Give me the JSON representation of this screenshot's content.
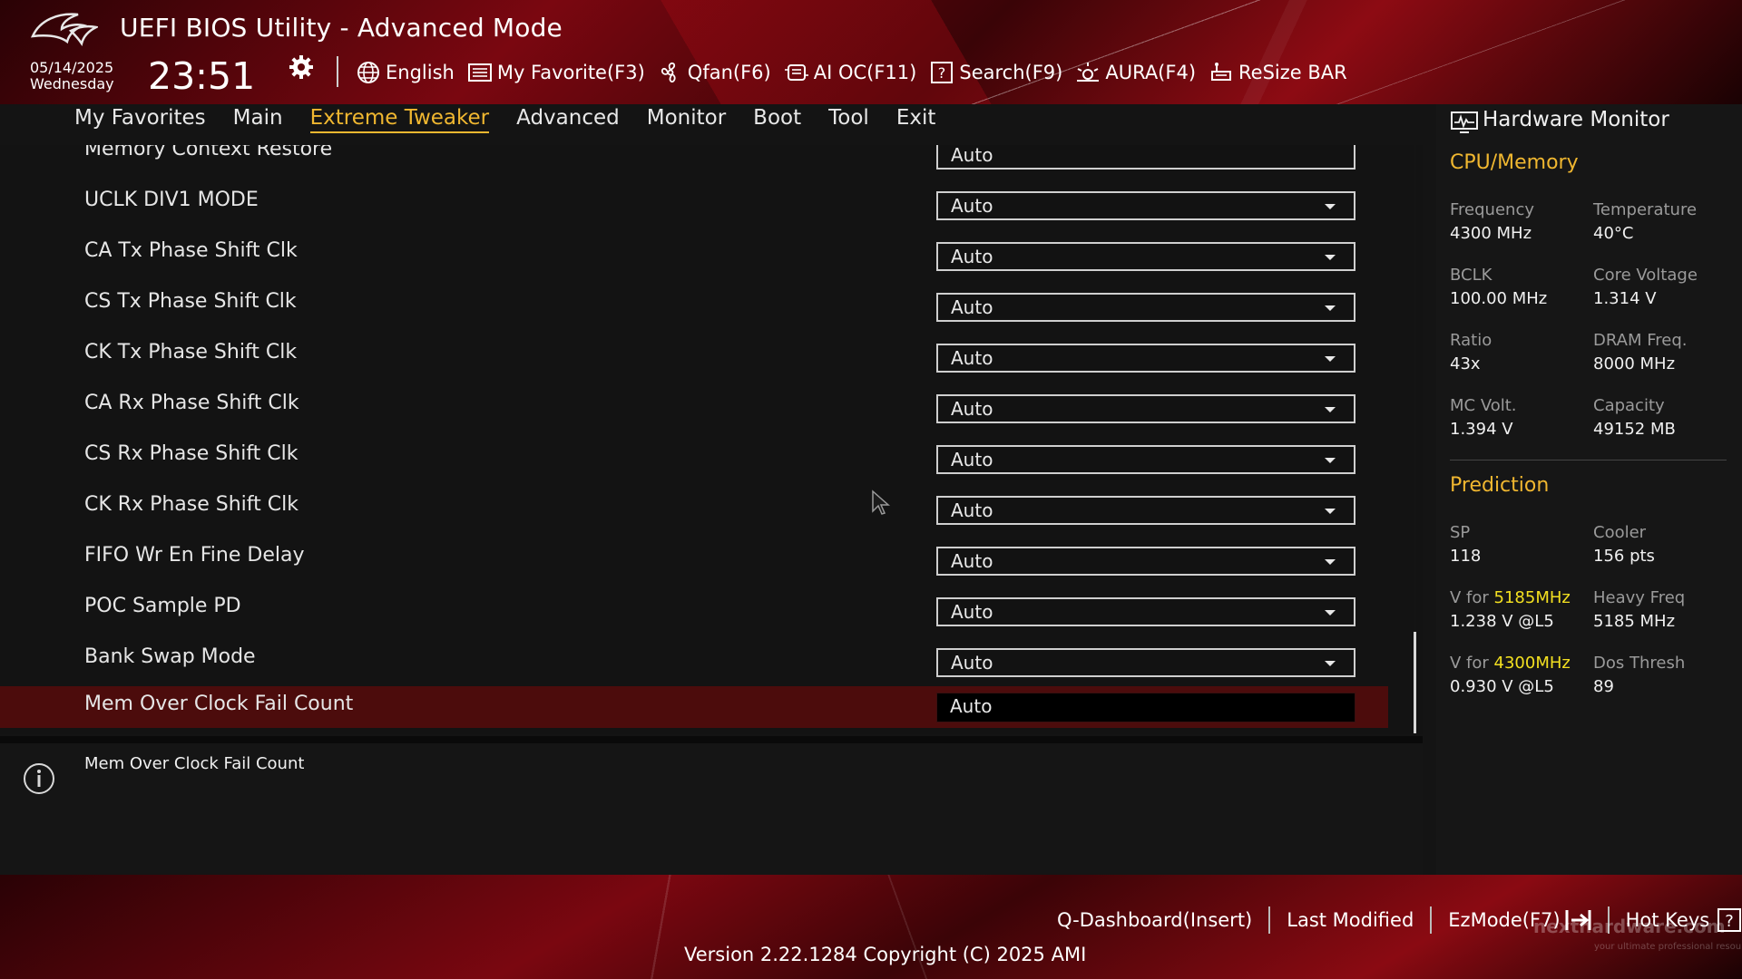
{
  "header": {
    "title": "UEFI BIOS Utility - Advanced Mode",
    "date": "05/14/2025",
    "day": "Wednesday",
    "time": "23:51",
    "toolbar": [
      {
        "icon": "globe-icon",
        "label": "English"
      },
      {
        "icon": "my-favorite-icon",
        "label": "My Favorite(F3)"
      },
      {
        "icon": "fan-icon",
        "label": "Qfan(F6)"
      },
      {
        "icon": "ai-oc-icon",
        "label": "AI OC(F11)"
      },
      {
        "icon": "search-help-icon",
        "label": "Search(F9)"
      },
      {
        "icon": "aura-icon",
        "label": "AURA(F4)"
      },
      {
        "icon": "resize-bar-icon",
        "label": "ReSize BAR"
      }
    ]
  },
  "menu": {
    "items": [
      "My Favorites",
      "Main",
      "Extreme Tweaker",
      "Advanced",
      "Monitor",
      "Boot",
      "Tool",
      "Exit"
    ],
    "active": "Extreme Tweaker"
  },
  "settings": {
    "partial_top": {
      "label": "Memory Context Restore",
      "value": "Auto"
    },
    "rows": [
      {
        "label": "UCLK DIV1 MODE",
        "value": "Auto"
      },
      {
        "label": "CA Tx Phase Shift Clk",
        "value": "Auto"
      },
      {
        "label": "CS Tx Phase Shift Clk",
        "value": "Auto"
      },
      {
        "label": "CK Tx Phase Shift Clk",
        "value": "Auto"
      },
      {
        "label": "CA Rx Phase Shift Clk",
        "value": "Auto"
      },
      {
        "label": "CS Rx Phase Shift Clk",
        "value": "Auto"
      },
      {
        "label": "CK Rx Phase Shift Clk",
        "value": "Auto"
      },
      {
        "label": "FIFO Wr En Fine Delay",
        "value": "Auto"
      },
      {
        "label": "POC Sample PD",
        "value": "Auto"
      },
      {
        "label": "Bank Swap Mode",
        "value": "Auto"
      }
    ],
    "selected": {
      "label": "Mem Over Clock Fail Count",
      "value": "Auto"
    }
  },
  "help": {
    "text": "Mem Over Clock Fail Count"
  },
  "hardware_monitor": {
    "title": "Hardware Monitor",
    "cpu_memory": {
      "title": "CPU/Memory",
      "frequency": {
        "label": "Frequency",
        "value": "4300 MHz"
      },
      "temperature": {
        "label": "Temperature",
        "value": "40°C"
      },
      "bclk": {
        "label": "BCLK",
        "value": "100.00 MHz"
      },
      "core_voltage": {
        "label": "Core Voltage",
        "value": "1.314 V"
      },
      "ratio": {
        "label": "Ratio",
        "value": "43x"
      },
      "dram_freq": {
        "label": "DRAM Freq.",
        "value": "8000 MHz"
      },
      "mc_volt": {
        "label": "MC Volt.",
        "value": "1.394 V"
      },
      "capacity": {
        "label": "Capacity",
        "value": "49152 MB"
      }
    },
    "prediction": {
      "title": "Prediction",
      "sp": {
        "label": "SP",
        "value": "118"
      },
      "cooler": {
        "label": "Cooler",
        "value": "156 pts"
      },
      "v_for_1": {
        "label_prefix": "V for",
        "freq": "5185MHz",
        "value": "1.238 V @L5"
      },
      "heavy_freq": {
        "label": "Heavy Freq",
        "value": "5185 MHz"
      },
      "v_for_2": {
        "label_prefix": "V for",
        "freq": "4300MHz",
        "value": "0.930 V @L5"
      },
      "dos_thresh": {
        "label": "Dos Thresh",
        "value": "89"
      }
    }
  },
  "footer": {
    "q_dashboard": "Q-Dashboard(Insert)",
    "last_modified": "Last Modified",
    "ez_mode": "EzMode(F7)",
    "hot_keys": "Hot Keys",
    "version": "Version 2.22.1284 Copyright (C) 2025 AMI",
    "watermark": "nexthardware.com",
    "watermark_sub": "your ultimate professional resource"
  },
  "colors": {
    "accent": "#f0b730",
    "highlight": "#f3e020",
    "selected_row": "#4c0c0c",
    "brand_red": "#8a0a12"
  }
}
